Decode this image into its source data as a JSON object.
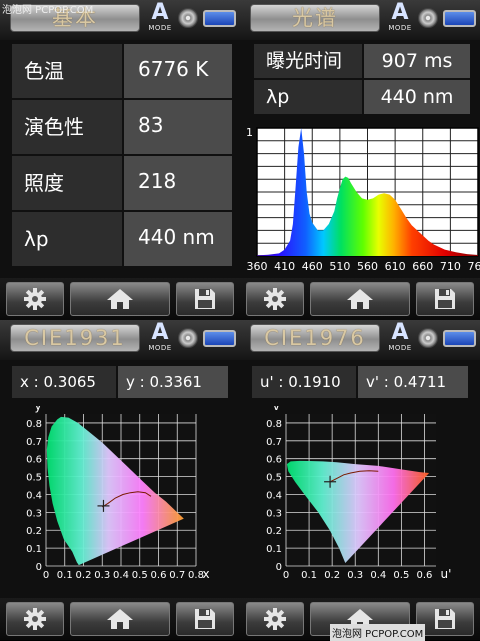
{
  "panels": {
    "basic": {
      "title": "基本",
      "mode_big": "A",
      "mode_small": "MODE"
    },
    "spectrum": {
      "title": "光谱",
      "mode_big": "A",
      "mode_small": "MODE"
    },
    "cie1931": {
      "title": "CIE1931",
      "mode_big": "A",
      "mode_small": "MODE"
    },
    "cie1976": {
      "title": "CIE1976",
      "mode_big": "A",
      "mode_small": "MODE"
    }
  },
  "basic": {
    "rows": [
      {
        "label": "色温",
        "value": "6776 K"
      },
      {
        "label": "演色性",
        "value": "83"
      },
      {
        "label": "照度",
        "value": "218"
      },
      {
        "label": "λp",
        "value": "440 nm"
      }
    ]
  },
  "spectrum": {
    "rows": [
      {
        "label": "曝光时间",
        "value": "907 ms"
      },
      {
        "label": "λp",
        "value": "440 nm"
      }
    ]
  },
  "chart_data": [
    {
      "type": "area",
      "x": [
        360,
        380,
        400,
        410,
        420,
        425,
        430,
        435,
        440,
        445,
        450,
        455,
        460,
        470,
        480,
        490,
        500,
        505,
        510,
        515,
        520,
        525,
        530,
        540,
        550,
        560,
        570,
        580,
        590,
        600,
        610,
        620,
        630,
        640,
        650,
        660,
        670,
        680,
        700,
        720,
        740,
        760
      ],
      "values": [
        0.005,
        0.01,
        0.02,
        0.05,
        0.12,
        0.25,
        0.55,
        0.85,
        1.0,
        0.8,
        0.5,
        0.33,
        0.26,
        0.2,
        0.2,
        0.25,
        0.35,
        0.45,
        0.53,
        0.6,
        0.62,
        0.61,
        0.57,
        0.5,
        0.45,
        0.44,
        0.45,
        0.48,
        0.49,
        0.48,
        0.44,
        0.37,
        0.3,
        0.24,
        0.2,
        0.16,
        0.12,
        0.09,
        0.05,
        0.03,
        0.015,
        0.008
      ],
      "xticks": [
        "360",
        "410",
        "460",
        "510",
        "560",
        "610",
        "660",
        "710",
        "760"
      ],
      "ymax_label": "1",
      "xlim": [
        360,
        760
      ],
      "ylim": [
        0,
        1
      ]
    },
    {
      "type": "scatter",
      "name": "CIE1931",
      "xlabel": "x",
      "ylabel": "y",
      "xticks": [
        "0",
        "0.1",
        "0.2",
        "0.3",
        "0.4",
        "0.5",
        "0.6",
        "0.7",
        "0.8"
      ],
      "yticks": [
        "0",
        "0.1",
        "0.2",
        "0.3",
        "0.4",
        "0.5",
        "0.6",
        "0.7",
        "0.8"
      ],
      "xlim": [
        0,
        0.8
      ],
      "ylim": [
        0,
        0.85
      ],
      "point": [
        0.3065,
        0.3361
      ]
    },
    {
      "type": "scatter",
      "name": "CIE1976",
      "xlabel": "u'",
      "ylabel": "v'",
      "xticks": [
        "0",
        "0.1",
        "0.2",
        "0.3",
        "0.4",
        "0.5",
        "0.6"
      ],
      "yticks": [
        "0",
        "0.1",
        "0.2",
        "0.3",
        "0.4",
        "0.5",
        "0.6",
        "0.7",
        "0.8"
      ],
      "xlim": [
        0,
        0.65
      ],
      "ylim": [
        0,
        0.85
      ],
      "point": [
        0.191,
        0.4711
      ]
    }
  ],
  "cie1931": {
    "x_text": "x : 0.3065",
    "y_text": "y : 0.3361"
  },
  "cie1976": {
    "u_text": "u' : 0.1910",
    "v_text": "v' : 0.4711"
  },
  "icons": [
    "gear-icon",
    "home-icon",
    "save-icon",
    "lens-icon",
    "battery-icon"
  ],
  "watermark": {
    "top_left": "泡泡网 PCPOP.COM",
    "bottom_right": "泡泡网 PCPOP.COM"
  }
}
